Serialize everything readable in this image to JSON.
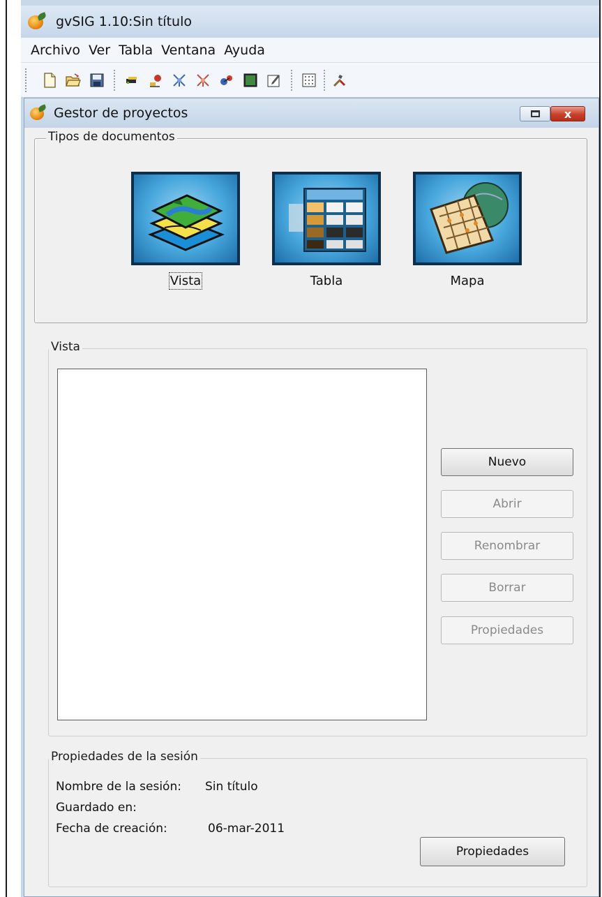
{
  "window": {
    "title": "gvSIG 1.10:Sin título"
  },
  "menu": [
    {
      "label": "Archivo"
    },
    {
      "label": "Ver"
    },
    {
      "label": "Tabla"
    },
    {
      "label": "Ventana"
    },
    {
      "label": "Ayuda"
    }
  ],
  "toolbar": {
    "groups": [
      [
        "new-project-icon",
        "open-project-icon",
        "save-project-icon"
      ],
      [
        "add-layer-icon",
        "geoprocessing-icon",
        "network-analysis-icon",
        "raster-tools-icon",
        "georeferencing-icon",
        "console-icon",
        "edit-icon"
      ],
      [
        "grid-icon",
        "preferences-tools-icon"
      ]
    ]
  },
  "dialog": {
    "title": "Gestor de proyectos",
    "close_label": "x",
    "doc_types": {
      "legend": "Tipos de documentos",
      "items": [
        {
          "label": "Vista",
          "icon": "view-layers-icon",
          "selected": true
        },
        {
          "label": "Tabla",
          "icon": "table-icon",
          "selected": false
        },
        {
          "label": "Mapa",
          "icon": "map-icon",
          "selected": false
        }
      ]
    },
    "documents": {
      "legend": "Vista",
      "items": [],
      "buttons": {
        "new": "Nuevo",
        "open": "Abrir",
        "rename": "Renombrar",
        "delete": "Borrar",
        "properties": "Propiedades"
      }
    },
    "session": {
      "legend": "Propiedades de la sesión",
      "name_label": "Nombre de la sesión:",
      "name_value": "Sin título",
      "saved_label": "Guardado en:",
      "saved_value": "",
      "date_label": "Fecha de creación:",
      "date_value": "06-mar-2011",
      "properties_button": "Propiedades"
    }
  }
}
